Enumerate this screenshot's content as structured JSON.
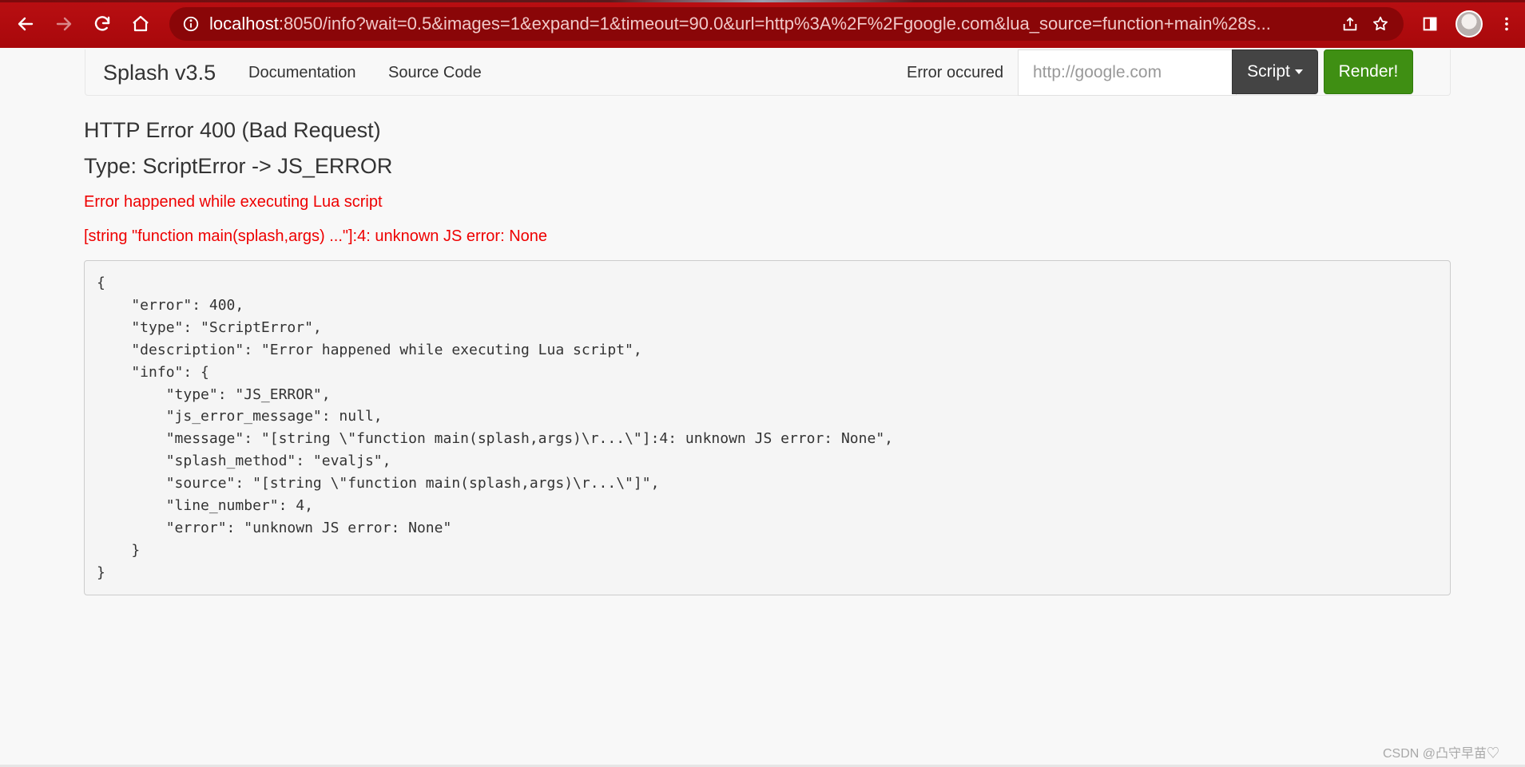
{
  "browser": {
    "url_host": "localhost",
    "url_rest": ":8050/info?wait=0.5&images=1&expand=1&timeout=90.0&url=http%3A%2F%2Fgoogle.com&lua_source=function+main%28s...",
    "accent_color": "#b90f12",
    "icons": [
      "back-arrow-icon",
      "forward-arrow-icon",
      "reload-icon",
      "home-icon",
      "info-icon",
      "share-icon",
      "star-icon",
      "side-panel-icon",
      "avatar",
      "kebab-menu-icon"
    ]
  },
  "navbar": {
    "brand": "Splash v3.5",
    "links": [
      "Documentation",
      "Source Code"
    ],
    "status": "Error occured",
    "url_placeholder": "http://google.com",
    "script_label": "Script",
    "render_label": "Render!",
    "render_color": "#3f8f13"
  },
  "error": {
    "title": "HTTP Error 400 (Bad Request)",
    "type_line": "Type: ScriptError -> JS_ERROR",
    "description": "Error happened while executing Lua script",
    "message": "[string \"function main(splash,args) ...\"]:4: unknown JS error: None",
    "error_color": "#ee0000",
    "json_text": "{\n    \"error\": 400,\n    \"type\": \"ScriptError\",\n    \"description\": \"Error happened while executing Lua script\",\n    \"info\": {\n        \"type\": \"JS_ERROR\",\n        \"js_error_message\": null,\n        \"message\": \"[string \\\"function main(splash,args)\\r...\\\"]:4: unknown JS error: None\",\n        \"splash_method\": \"evaljs\",\n        \"source\": \"[string \\\"function main(splash,args)\\r...\\\"]\",\n        \"line_number\": 4,\n        \"error\": \"unknown JS error: None\"\n    }\n}"
  },
  "watermark": "CSDN @凸守早苗♡"
}
